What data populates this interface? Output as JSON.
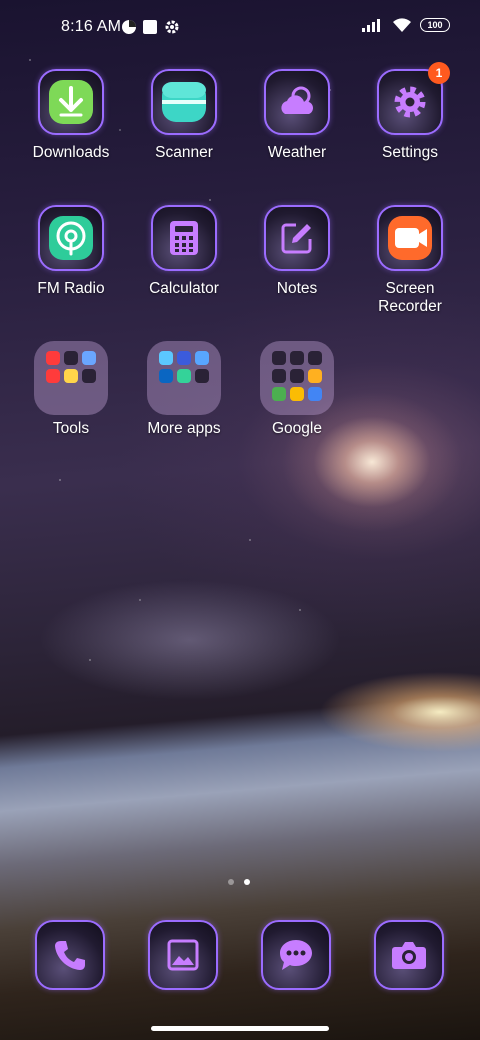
{
  "status_bar": {
    "time": "8:16 AM",
    "battery": "100",
    "icons": [
      "vpn-icon",
      "notification-icon",
      "settings-icon",
      "signal-icon",
      "wifi-icon",
      "battery-icon"
    ]
  },
  "apps": [
    {
      "label": "Downloads",
      "icon": "download-arrow-icon",
      "accent": "#7ed957"
    },
    {
      "label": "Scanner",
      "icon": "scanner-icon",
      "accent": "#3dd6c6"
    },
    {
      "label": "Weather",
      "icon": "cloud-icon",
      "accent": "#c77dff"
    },
    {
      "label": "Settings",
      "icon": "gear-icon",
      "accent": "#c77dff",
      "badge": "1"
    },
    {
      "label": "FM Radio",
      "icon": "radio-icon",
      "accent": "#2ecc9a"
    },
    {
      "label": "Calculator",
      "icon": "calculator-icon",
      "accent": "#c77dff"
    },
    {
      "label": "Notes",
      "icon": "pen-note-icon",
      "accent": "#c77dff"
    },
    {
      "label": "Screen Recorder",
      "icon": "video-camera-icon",
      "accent": "#ff6a2b"
    }
  ],
  "folders": [
    {
      "label": "Tools"
    },
    {
      "label": "More apps"
    },
    {
      "label": "Google"
    }
  ],
  "dock": [
    {
      "icon": "phone-icon"
    },
    {
      "icon": "gallery-icon"
    },
    {
      "icon": "messages-icon"
    },
    {
      "icon": "camera-icon"
    }
  ],
  "page_indicator": {
    "pages": 2,
    "current": 2
  },
  "colors": {
    "tile_border": "#9b6cff",
    "glyph_purple": "#c77dff",
    "badge": "#ff5a1f"
  }
}
